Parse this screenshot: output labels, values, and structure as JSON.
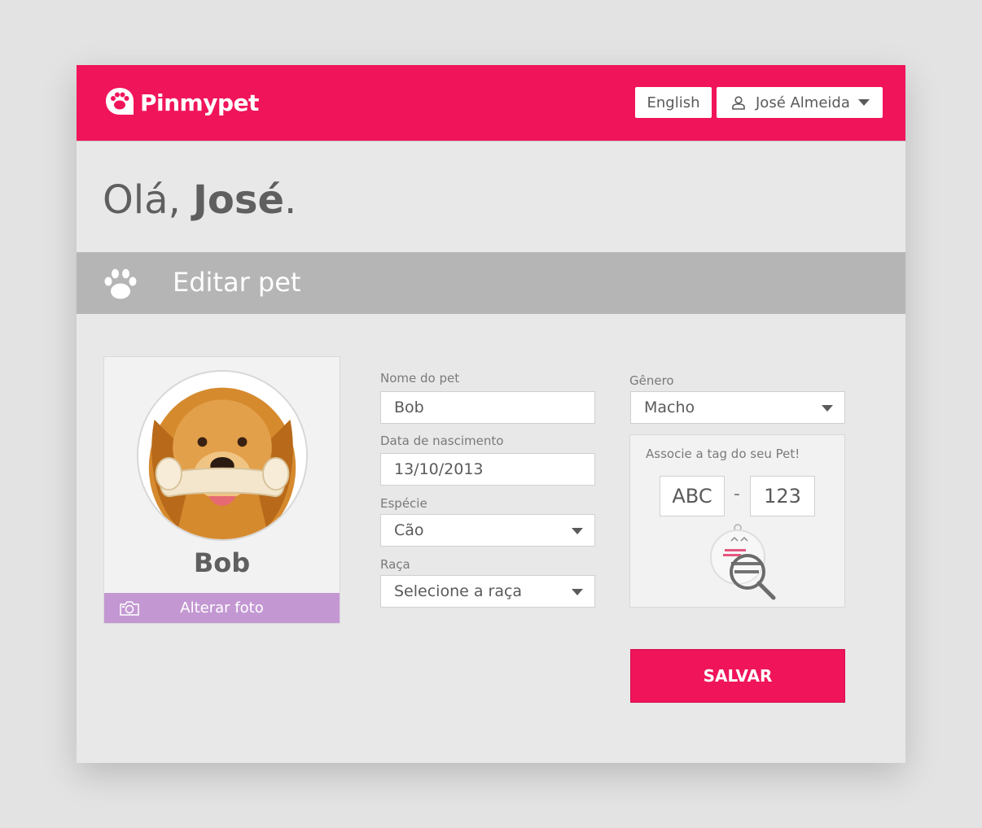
{
  "brand": {
    "name": "Pinmypet",
    "color": "#f0145a"
  },
  "header": {
    "language_label": "English",
    "user_name": "José Almeida"
  },
  "greeting": {
    "prefix": "Olá, ",
    "name": "José",
    "suffix": "."
  },
  "section": {
    "title": "Editar pet",
    "icon": "paw-icon"
  },
  "pet": {
    "name": "Bob",
    "change_photo_label": "Alterar foto"
  },
  "form": {
    "name_label": "Nome do pet",
    "name_value": "Bob",
    "birth_label": "Data de nascimento",
    "birth_value": "13/10/2013",
    "species_label": "Espécie",
    "species_value": "Cão",
    "breed_label": "Raça",
    "breed_value": "Selecione a raça",
    "gender_label": "Gênero",
    "gender_value": "Macho"
  },
  "tag": {
    "label": "Associe a tag do seu Pet!",
    "code_part1": "ABC",
    "separator": "-",
    "code_part2": "123"
  },
  "actions": {
    "save_label": "SALVAR"
  }
}
